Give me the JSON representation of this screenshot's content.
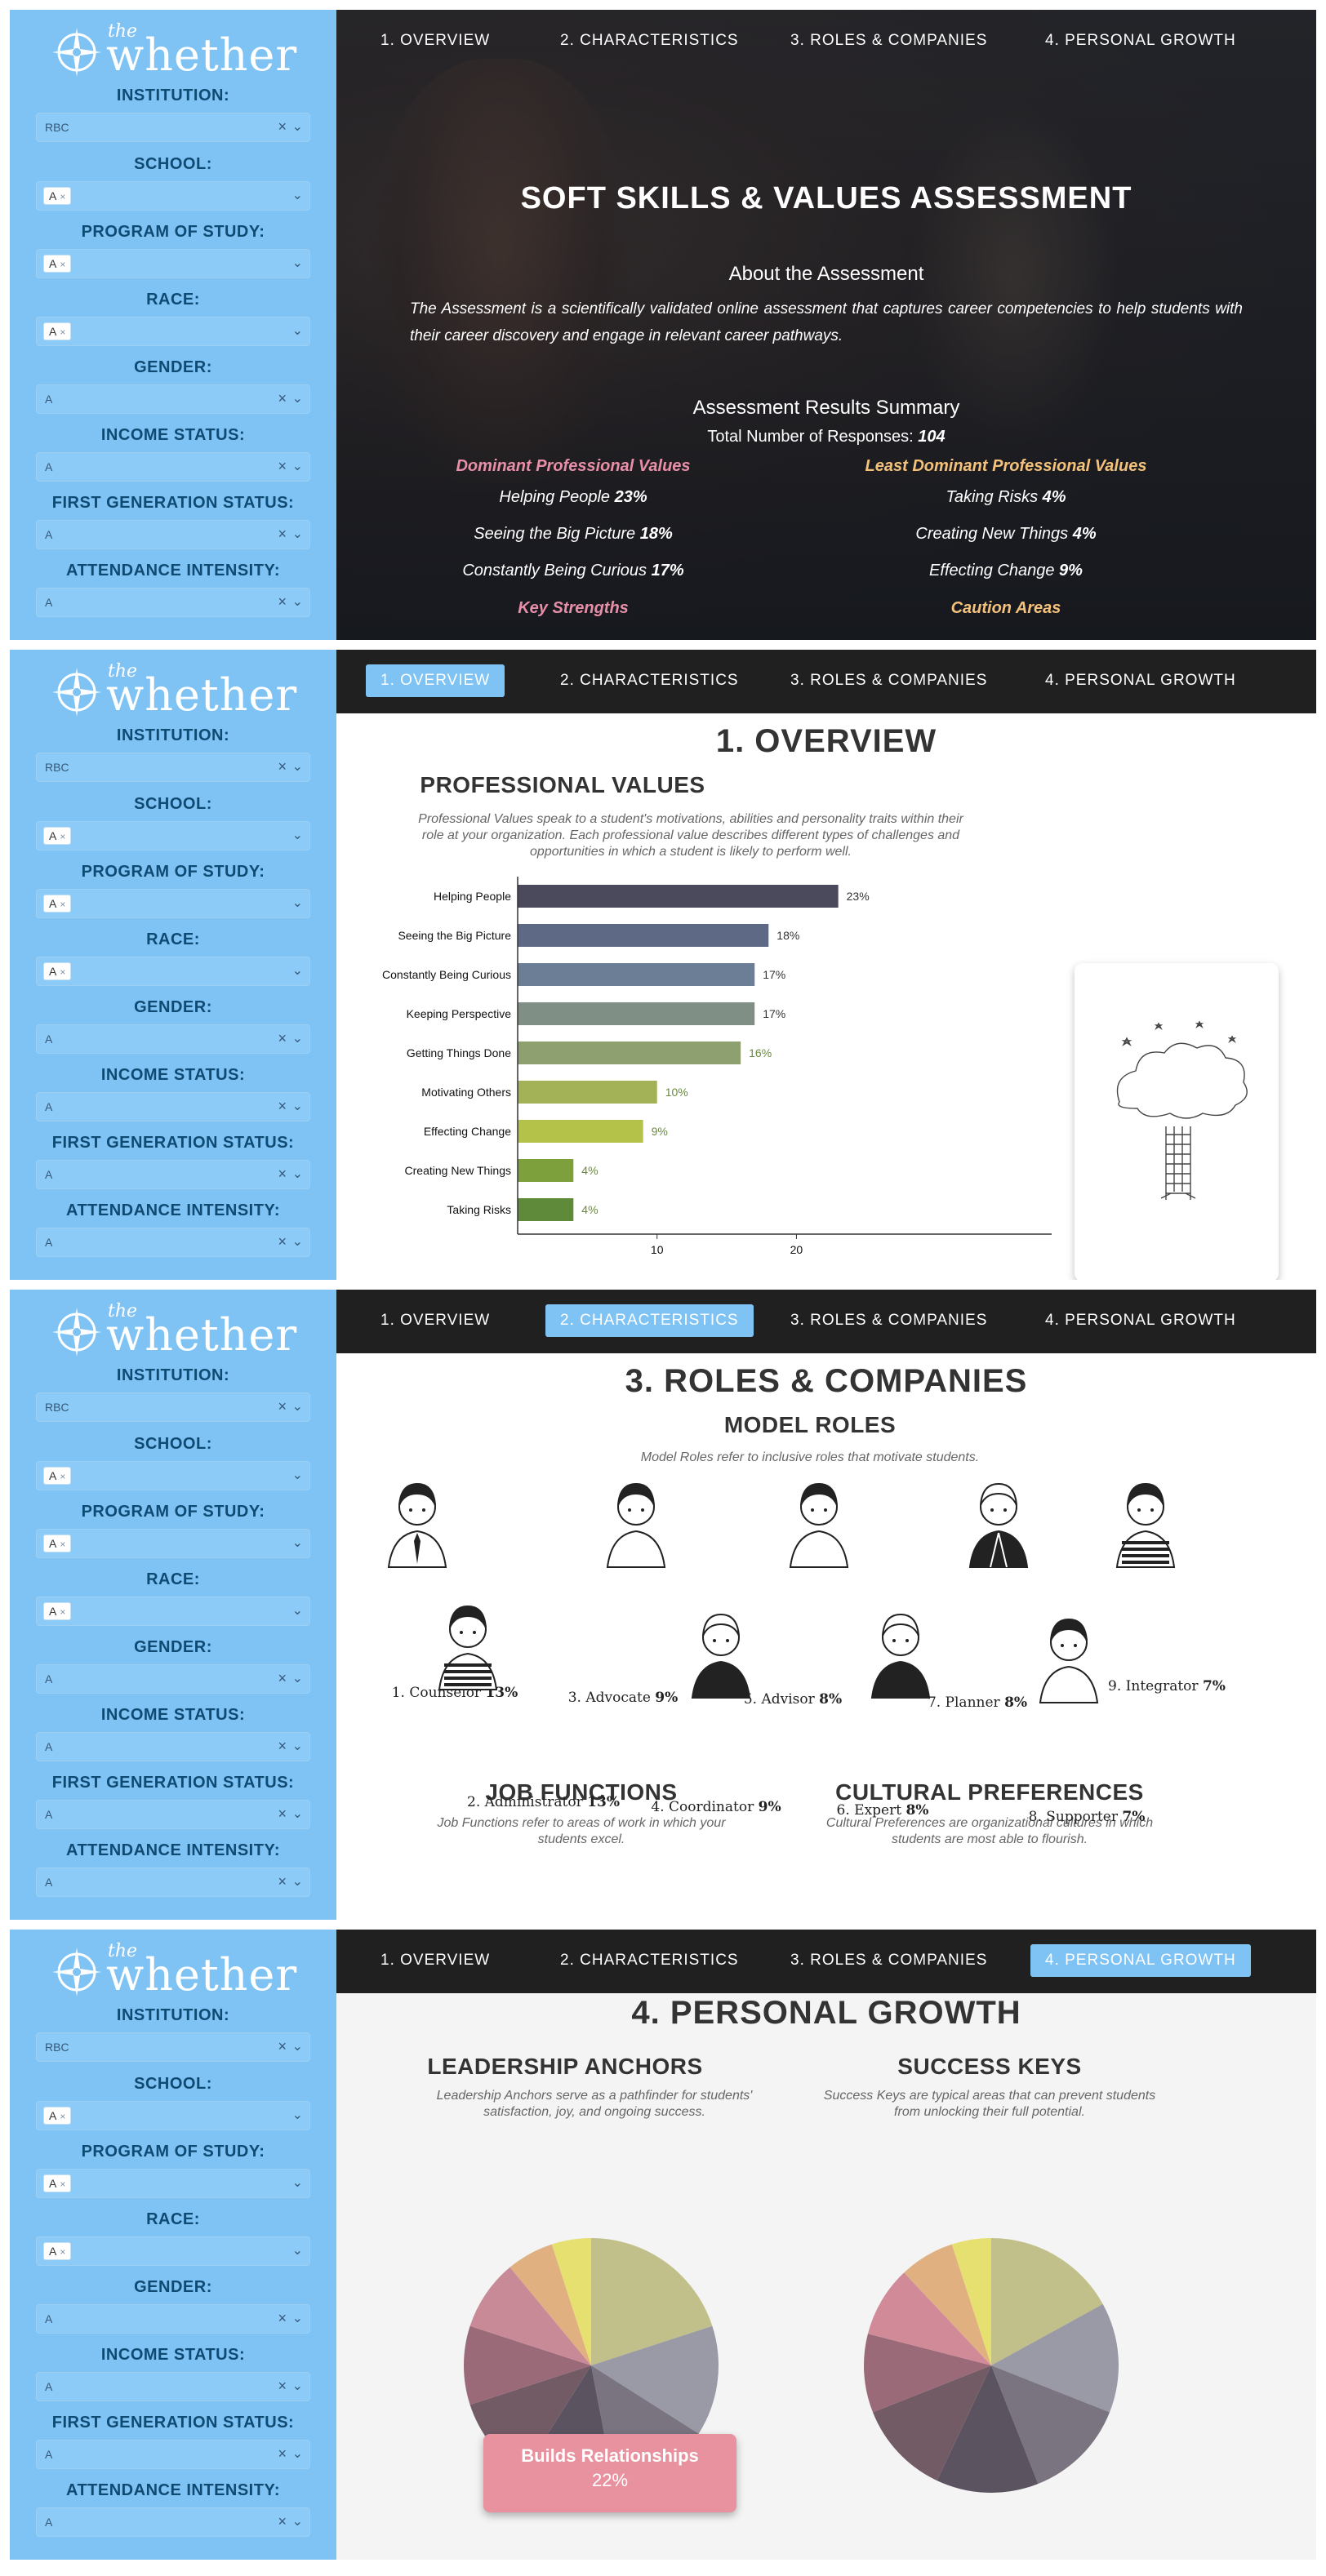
{
  "brand": {
    "the": "the",
    "name": "whether"
  },
  "nav": [
    "1. OVERVIEW",
    "2. CHARACTERISTICS",
    "3. ROLES & COMPANIES",
    "4. PERSONAL GROWTH"
  ],
  "filters": [
    {
      "label": "INSTITUTION:",
      "value": "RBC",
      "chip": false
    },
    {
      "label": "SCHOOL:",
      "value": "A",
      "chip": true
    },
    {
      "label": "PROGRAM OF STUDY:",
      "value": "A",
      "chip": true
    },
    {
      "label": "RACE:",
      "value": "A",
      "chip": true
    },
    {
      "label": "GENDER:",
      "value": "A",
      "chip": false
    },
    {
      "label": "INCOME STATUS:",
      "value": "A",
      "chip": false
    },
    {
      "label": "FIRST GENERATION STATUS:",
      "value": "A",
      "chip": false
    },
    {
      "label": "ATTENDANCE INTENSITY:",
      "value": "A",
      "chip": false
    }
  ],
  "hero": {
    "title": "SOFT SKILLS & VALUES ASSESSMENT",
    "about_heading": "About the Assessment",
    "about_text": "The Assessment is a scientifically validated online assessment that captures career competencies to help students with their career discovery and engage in relevant career pathways.",
    "summary_heading": "Assessment Results Summary",
    "responses_label": "Total Number of Responses:",
    "responses_value": "104",
    "dominant_heading": "Dominant Professional Values",
    "least_heading": "Least Dominant Professional Values",
    "dominant": [
      {
        "name": "Helping People",
        "pct": "23%"
      },
      {
        "name": "Seeing the Big Picture",
        "pct": "18%"
      },
      {
        "name": "Constantly Being Curious",
        "pct": "17%"
      }
    ],
    "least": [
      {
        "name": "Taking Risks",
        "pct": "4%"
      },
      {
        "name": "Creating New Things",
        "pct": "4%"
      },
      {
        "name": "Effecting Change",
        "pct": "9%"
      }
    ],
    "strengths_heading": "Key Strengths",
    "caution_heading": "Caution Areas"
  },
  "overview": {
    "heading": "1. OVERVIEW",
    "section": "PROFESSIONAL VALUES",
    "desc": "Professional Values speak to a student's motivations, abilities and personality traits within their role at your organization. Each professional value describes different types of challenges and opportunities in which a student is likely to perform well."
  },
  "chart_data": {
    "type": "bar",
    "orientation": "horizontal",
    "categories": [
      "Helping People",
      "Seeing the Big Picture",
      "Constantly Being Curious",
      "Keeping Perspective",
      "Getting Things Done",
      "Motivating Others",
      "Effecting Change",
      "Creating New Things",
      "Taking Risks"
    ],
    "values": [
      23,
      18,
      17,
      17,
      16,
      10,
      9,
      4,
      4
    ],
    "value_labels": [
      "23%",
      "18%",
      "17%",
      "17%",
      "16%",
      "10%",
      "9%",
      "4%",
      "4%"
    ],
    "colors": [
      "#4a4a5c",
      "#5e6a85",
      "#6c7d96",
      "#7f8f86",
      "#8fa070",
      "#a3b256",
      "#b4c24a",
      "#7da03c",
      "#5f8a3a"
    ],
    "label_colors": [
      "#333333",
      "#333333",
      "#333333",
      "#333333",
      "#6a8a40",
      "#6a8a40",
      "#6a8a40",
      "#6a8a40",
      "#6a8a40"
    ],
    "xlim": [
      0,
      28
    ],
    "xticks": [
      10,
      20
    ]
  },
  "roles": {
    "heading": "3. ROLES & COMPANIES",
    "section": "MODEL ROLES",
    "desc": "Model Roles refer to inclusive roles that motivate students.",
    "items": [
      {
        "name": "1. Counselor",
        "pct": "13%"
      },
      {
        "name": "2. Administrator",
        "pct": "13%"
      },
      {
        "name": "3. Advocate",
        "pct": "9%"
      },
      {
        "name": "4. Coordinator",
        "pct": "9%"
      },
      {
        "name": "5. Advisor",
        "pct": "8%"
      },
      {
        "name": "6. Expert",
        "pct": "8%"
      },
      {
        "name": "7. Planner",
        "pct": "8%"
      },
      {
        "name": "8. Supporter",
        "pct": "7%"
      },
      {
        "name": "9. Integrator",
        "pct": "7%"
      }
    ],
    "job_heading": "JOB FUNCTIONS",
    "job_desc": "Job Functions refer to areas of work in which your students excel.",
    "culture_heading": "CULTURAL PREFERENCES",
    "culture_desc": "Cultural Preferences are organizational cultures in which students are most able to flourish."
  },
  "growth": {
    "heading": "4. PERSONAL GROWTH",
    "leadership_heading": "LEADERSHIP ANCHORS",
    "leadership_desc": "Leadership Anchors serve as a pathfinder for students' satisfaction, joy, and ongoing success.",
    "success_heading": "SUCCESS KEYS",
    "success_desc": "Success Keys are typical areas that can prevent students from unlocking their full potential.",
    "tooltip_label": "Builds Relationships",
    "tooltip_value": "22%",
    "pie_colors_left": [
      "#c2c08a",
      "#9a9aa6",
      "#7a7480",
      "#5c5360",
      "#735b66",
      "#9a6a78",
      "#c98a98",
      "#e0b080",
      "#e6e070"
    ],
    "pie_values_left": [
      20,
      14,
      13,
      12,
      11,
      10,
      9,
      6,
      5
    ],
    "pie_colors_right": [
      "#c2c08a",
      "#9a9aa6",
      "#7a7480",
      "#5c5360",
      "#735b66",
      "#9a6a78",
      "#d08a98",
      "#e0b080",
      "#e6e070"
    ],
    "pie_values_right": [
      17,
      14,
      13,
      13,
      12,
      10,
      9,
      7,
      5
    ]
  }
}
